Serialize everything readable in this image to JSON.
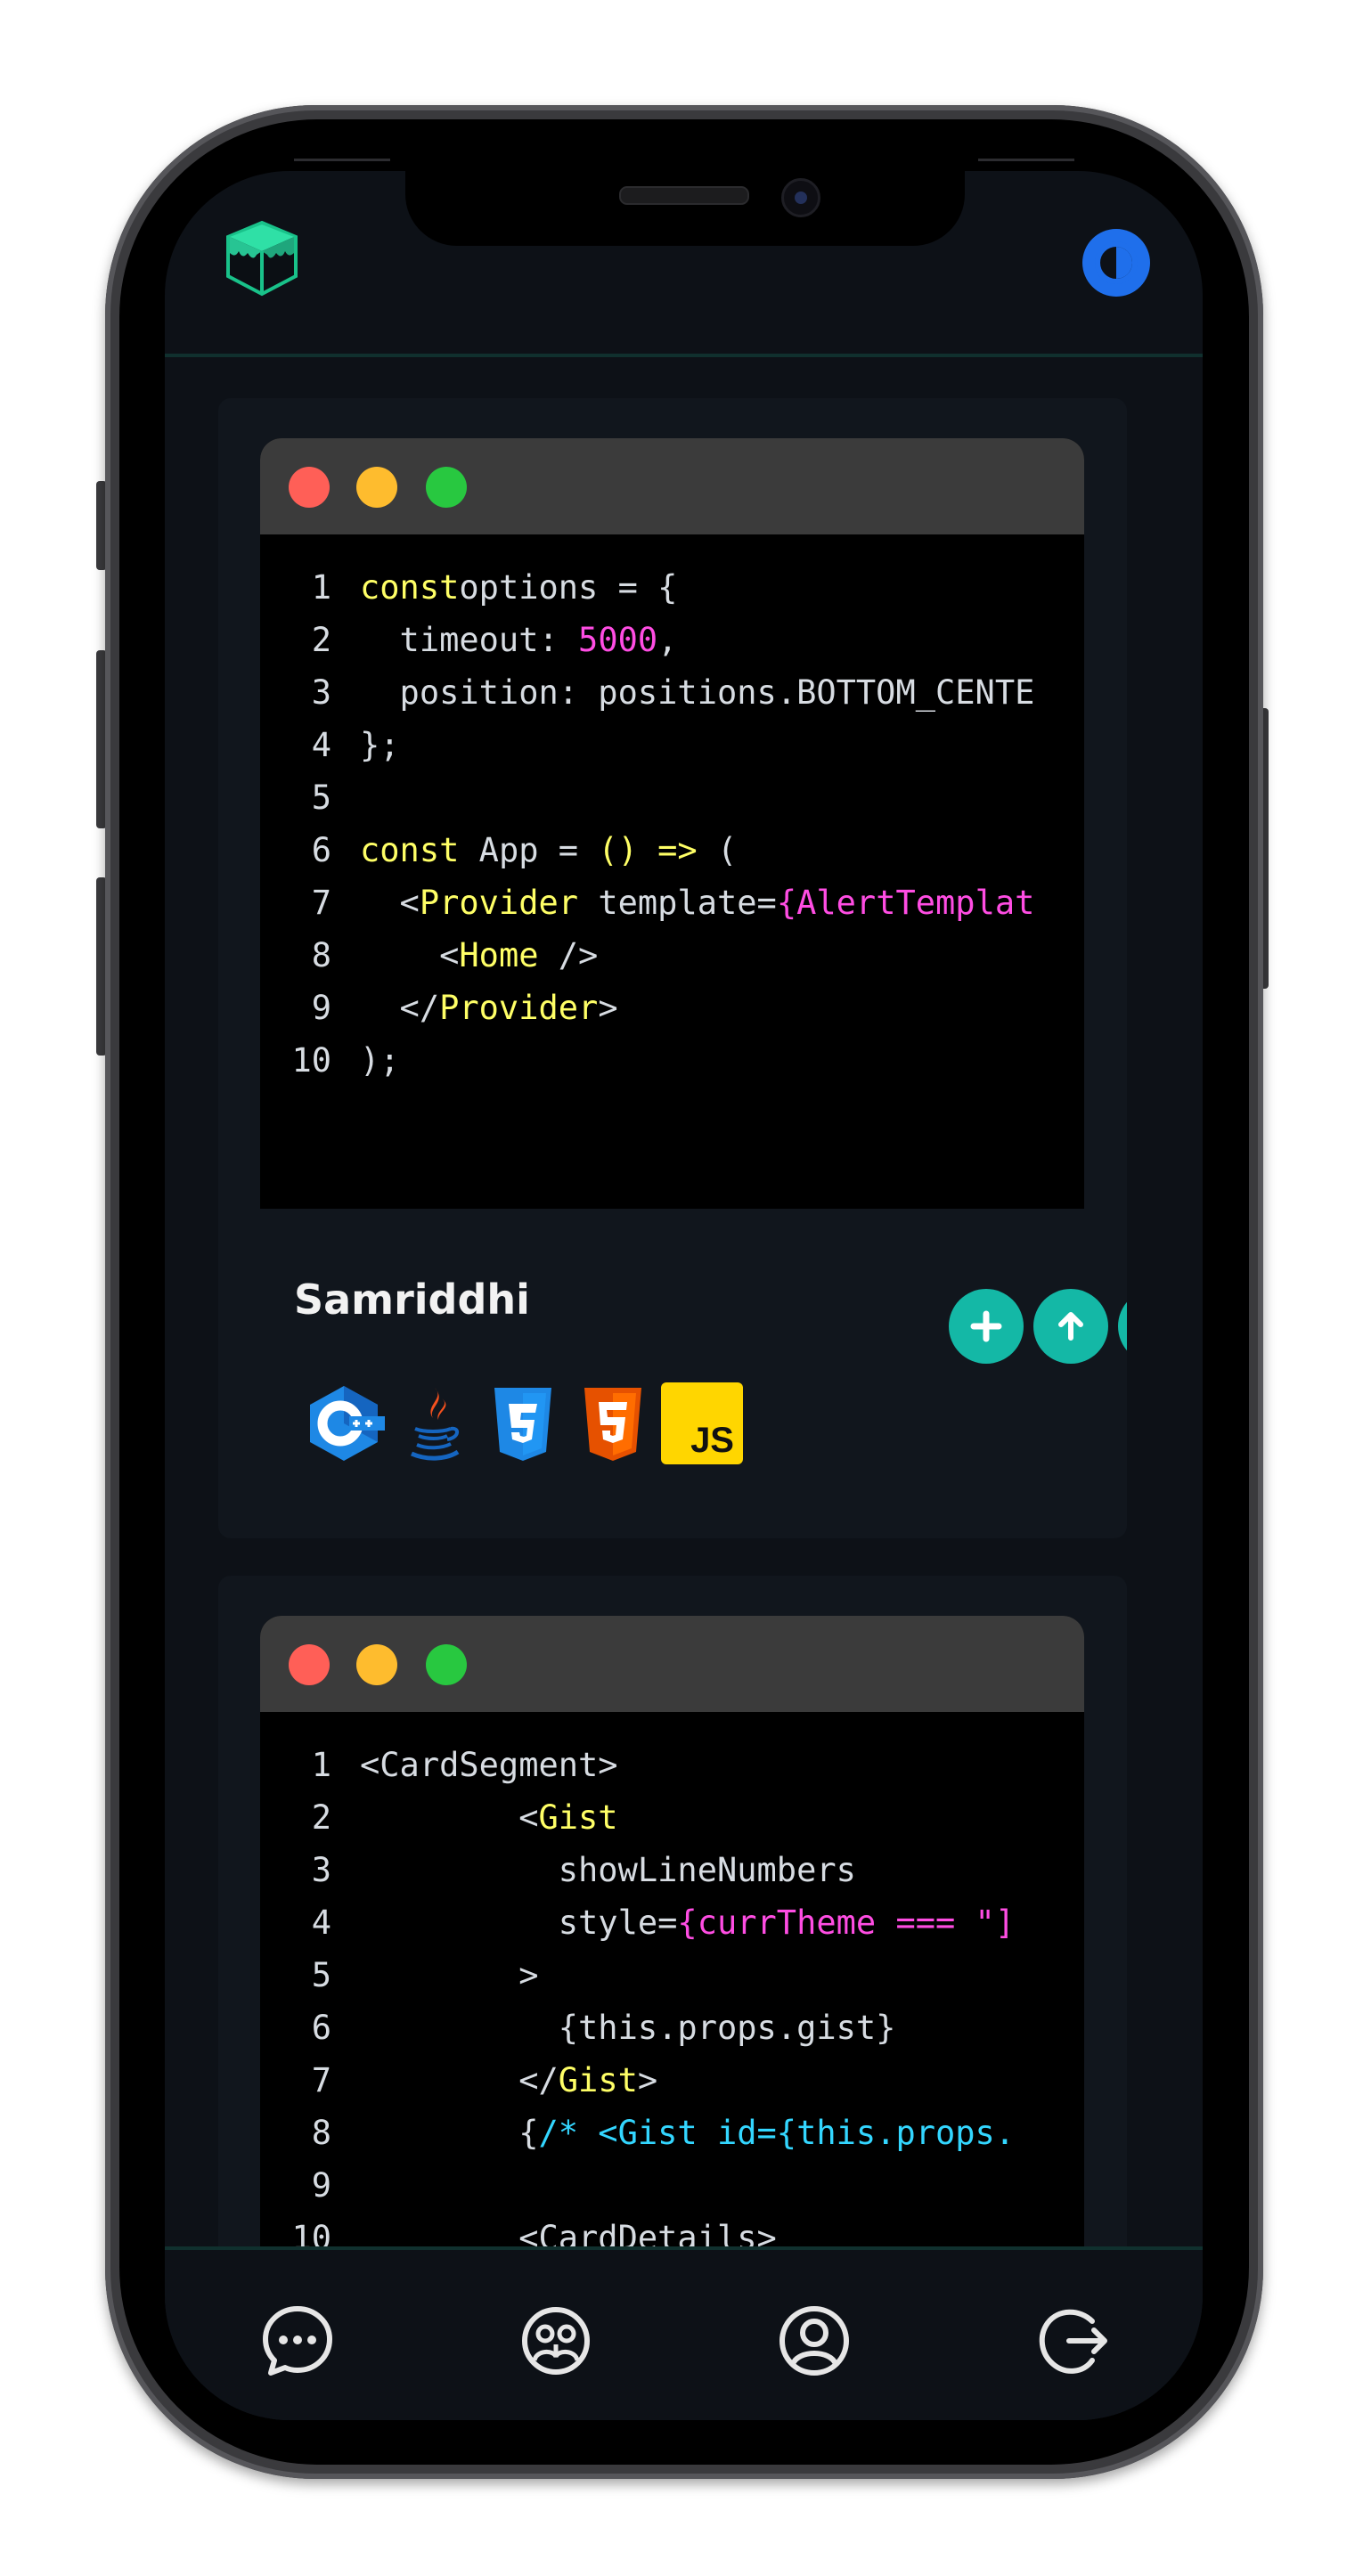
{
  "app": {
    "logo_icon": "cube-logo-icon",
    "theme_toggle_icon": "half-circle-contrast-icon",
    "accent_color": "#14b8a6",
    "theme_toggle_color": "#1f6feb"
  },
  "posts": [
    {
      "author": "Samriddhi",
      "code_lines": [
        {
          "n": "1",
          "parts": [
            [
              "kw",
              "const"
            ],
            [
              "",
              "options = {"
            ]
          ]
        },
        {
          "n": "2",
          "parts": [
            [
              "",
              "  timeout: "
            ],
            [
              "num",
              "5000"
            ],
            [
              "",
              ","
            ]
          ]
        },
        {
          "n": "3",
          "parts": [
            [
              "",
              "  position: positions.BOTTOM_CENTE"
            ]
          ]
        },
        {
          "n": "4",
          "parts": [
            [
              "",
              "};"
            ]
          ]
        },
        {
          "n": "5",
          "parts": []
        },
        {
          "n": "6",
          "parts": [
            [
              "kw",
              "const"
            ],
            [
              "",
              " App = "
            ],
            [
              "kw",
              "() =>"
            ],
            [
              "",
              " ("
            ]
          ]
        },
        {
          "n": "7",
          "parts": [
            [
              "",
              "  <"
            ],
            [
              "tag",
              "Provider"
            ],
            [
              "",
              " template="
            ],
            [
              "expr",
              "{AlertTemplat"
            ]
          ]
        },
        {
          "n": "8",
          "parts": [
            [
              "",
              "    <"
            ],
            [
              "tag",
              "Home"
            ],
            [
              "",
              " />"
            ]
          ]
        },
        {
          "n": "9",
          "parts": [
            [
              "",
              "  </"
            ],
            [
              "tag",
              "Provider"
            ],
            [
              "",
              ">"
            ]
          ]
        },
        {
          "n": "10",
          "parts": [
            [
              "",
              ");"
            ]
          ]
        }
      ],
      "actions": {
        "add_icon": "plus-icon",
        "upvote_icon": "arrow-up-icon",
        "downvote_icon": "arrow-down-icon"
      },
      "tech_icons": [
        "cplusplus-icon",
        "java-icon",
        "css3-icon",
        "html5-icon",
        "javascript-icon"
      ],
      "tech_labels": {
        "js": "JS"
      }
    },
    {
      "code_lines": [
        {
          "n": "1",
          "parts": [
            [
              "",
              "<CardSegment>"
            ]
          ]
        },
        {
          "n": "2",
          "parts": [
            [
              "",
              "        <"
            ],
            [
              "tag",
              "Gist"
            ]
          ]
        },
        {
          "n": "3",
          "parts": [
            [
              "",
              "          showLineNumbers"
            ]
          ]
        },
        {
          "n": "4",
          "parts": [
            [
              "",
              "          style="
            ],
            [
              "expr",
              "{currTheme === \"]"
            ]
          ]
        },
        {
          "n": "5",
          "parts": [
            [
              "",
              "        >"
            ]
          ]
        },
        {
          "n": "6",
          "parts": [
            [
              "",
              "          {this.props.gist}"
            ]
          ]
        },
        {
          "n": "7",
          "parts": [
            [
              "",
              "        </"
            ],
            [
              "tag",
              "Gist"
            ],
            [
              "",
              ">"
            ]
          ]
        },
        {
          "n": "8",
          "parts": [
            [
              "",
              "        {"
            ],
            [
              "cmt",
              "/* <Gist id={this.props."
            ]
          ]
        },
        {
          "n": "9",
          "parts": []
        },
        {
          "n": "10",
          "parts": [
            [
              "",
              "        <CardDetails>"
            ]
          ]
        }
      ]
    }
  ],
  "bottom_nav": [
    {
      "icon": "chat-bubble-icon"
    },
    {
      "icon": "community-icon"
    },
    {
      "icon": "user-profile-icon"
    },
    {
      "icon": "logout-icon"
    }
  ]
}
